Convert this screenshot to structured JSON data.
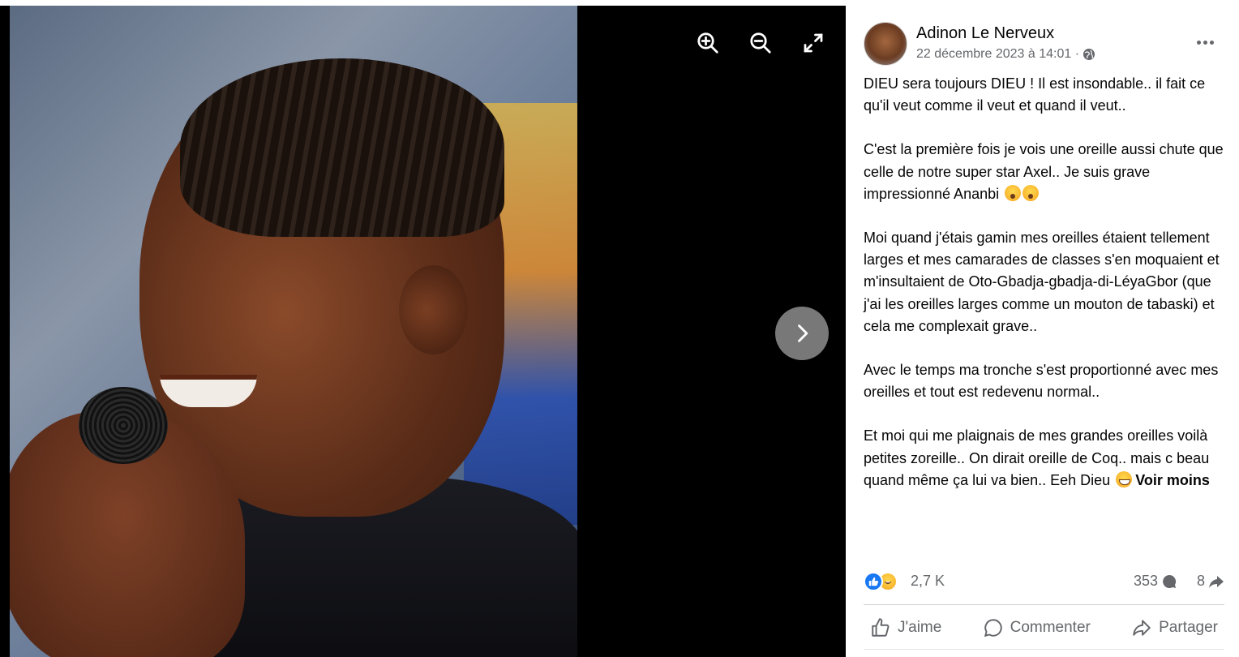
{
  "viewer": {
    "zoom_in_icon": "zoom-in-icon",
    "zoom_out_icon": "zoom-out-icon",
    "fullscreen_icon": "expand-icon",
    "next_icon": "chevron-right-icon",
    "background": "#000000"
  },
  "post": {
    "author": "Adinon Le Nerveux",
    "timestamp": "22 décembre 2023 à 14:01 ·",
    "privacy_icon": "globe-icon",
    "paragraphs": [
      "DIEU sera toujours DIEU ! Il est insondable.. il fait ce qu'il veut comme il veut et quand il veut..",
      "C'est la première fois je vois une oreille aussi chute que celle de notre super star Axel.. Je suis grave impressionné Ananbi",
      "Moi quand j'étais gamin mes oreilles étaient tellement larges et mes camarades de classes s'en moquaient et m'insultaient de Oto-Gbadja-gbadja-di-LéyaGbor (que j'ai les oreilles larges comme un mouton de tabaski) et cela me complexait grave..",
      "Avec le temps ma tronche s'est proportionné avec mes oreilles et tout est redevenu normal..",
      "Et moi qui me plaignais de mes grandes oreilles voilà petites zoreille.. On dirait oreille de Coq.. mais c beau quand même ça lui va bien.. Eeh Dieu"
    ],
    "see_less": "Voir moins"
  },
  "stats": {
    "reactions": "2,7 K",
    "comments": "353",
    "shares": "8"
  },
  "actions": {
    "like": "J'aime",
    "comment": "Commenter",
    "share": "Partager"
  },
  "colors": {
    "like_blue": "#1877f2",
    "secondary_text": "#65676b",
    "primary_text": "#050505"
  }
}
